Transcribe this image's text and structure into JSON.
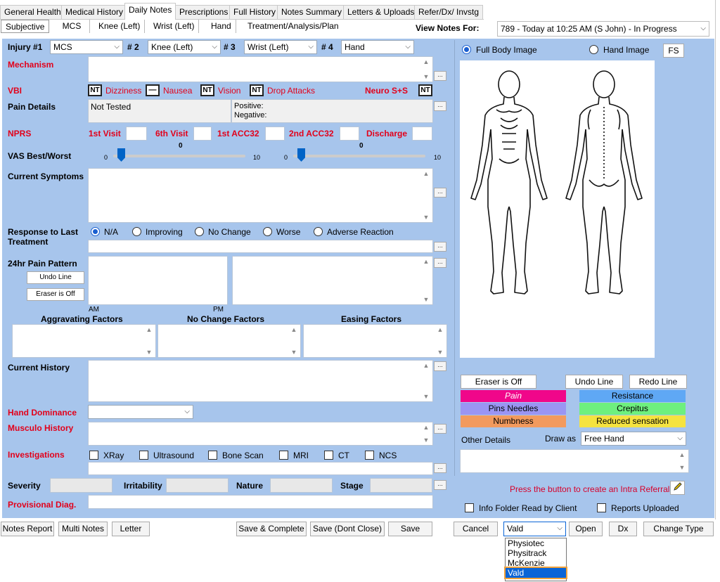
{
  "tabs": [
    "General Health",
    "Medical History",
    "Daily Notes",
    "Prescriptions",
    "Full History",
    "Notes Summary",
    "Letters & Uploads",
    "Refer/Dx/ Invstg"
  ],
  "subtabs": [
    "Subjective",
    "MCS",
    "Knee (Left)",
    "Wrist (Left)",
    "Hand",
    "Treatment/Analysis/Plan"
  ],
  "view_notes": {
    "label": "View Notes For:",
    "value": "789 - Today at 10:25 AM (S John) - In Progress"
  },
  "injuries": {
    "l1": "Injury #1",
    "v1": "MCS",
    "l2": "# 2",
    "v2": "Knee (Left)",
    "l3": "# 3",
    "v3": "Wrist (Left)",
    "l4": "# 4",
    "v4": "Hand"
  },
  "labels": {
    "mechanism": "Mechanism",
    "vbi": "VBI",
    "pain_details": "Pain Details",
    "npars": "NPRS",
    "vas": "VAS Best/Worst",
    "current_symptoms": "Current Symptoms",
    "response_last": "Response to Last",
    "treatment": "Treatment",
    "pain_pattern": "24hr Pain Pattern",
    "am": "AM",
    "pm": "PM",
    "aggravating": "Aggravating Factors",
    "no_change": "No Change Factors",
    "easing": "Easing Factors",
    "current_history": "Current History",
    "hand_dominance": "Hand Dominance",
    "musculo_history": "Musculo History",
    "investigations": "Investigations",
    "severity": "Severity",
    "irritability": "Irritability",
    "nature": "Nature",
    "stage": "Stage",
    "provisional": "Provisional Diag."
  },
  "vbi": {
    "nt": "NT",
    "dizziness": "Dizziness",
    "dash": "—",
    "nausea": "Nausea",
    "vision": "Vision",
    "drop": "Drop Attacks",
    "neuro": "Neuro S+S"
  },
  "pain": {
    "not_tested": "Not Tested",
    "positive": "Positive:",
    "negative": "Negative:"
  },
  "npars_fields": {
    "first": "1st Visit",
    "sixth": "6th Visit",
    "acc1": "1st ACC32",
    "acc2": "2nd ACC32",
    "discharge": "Discharge"
  },
  "vas": {
    "min": "0",
    "max": "10",
    "v1": "0",
    "v2": "0",
    "best": 0,
    "worst": 0
  },
  "response_options": [
    "N/A",
    "Improving",
    "No Change",
    "Worse",
    "Adverse Reaction"
  ],
  "pain_buttons": {
    "undo": "Undo Line",
    "eraser": "Eraser is Off"
  },
  "investigation_options": [
    "XRay",
    "Ultrasound",
    "Bone Scan",
    "MRI",
    "CT",
    "NCS"
  ],
  "body": {
    "full": "Full Body Image",
    "hand": "Hand Image",
    "fs": "FS"
  },
  "draw": {
    "eraser": "Eraser is Off",
    "undo": "Undo Line",
    "redo": "Redo Line"
  },
  "legend": [
    {
      "label": "Pain",
      "color": "#f0078a"
    },
    {
      "label": "Resistance",
      "color": "#5fa8f5"
    },
    {
      "label": "Pins  Needles",
      "color": "#9a95f3"
    },
    {
      "label": "Crepitus",
      "color": "#6ef07e"
    },
    {
      "label": "Numbness",
      "color": "#f29a5e"
    },
    {
      "label": "Reduced sensation",
      "color": "#f5e340"
    }
  ],
  "other": {
    "details": "Other Details",
    "draw_as": "Draw as",
    "draw_value": "Free Hand"
  },
  "referral": "Press the button to create an Intra Referral",
  "checks": {
    "info": "Info Folder Read by Client",
    "reports": "Reports Uploaded"
  },
  "bottom": {
    "notes_report": "Notes Report",
    "multi": "Multi Notes",
    "letter": "Letter",
    "save_complete": "Save & Complete",
    "save_dont": "Save (Dont Close)",
    "save": "Save",
    "cancel": "Cancel",
    "vald": "Vald",
    "open": "Open",
    "dx": "Dx",
    "change": "Change Type"
  },
  "dropdown_options": [
    "Physiotec",
    "Physitrack",
    "McKenzie",
    "Vald"
  ],
  "colors": {
    "panel": "#a7c5ec",
    "label_red": "#e2001a",
    "selection": "#0a64d6"
  }
}
